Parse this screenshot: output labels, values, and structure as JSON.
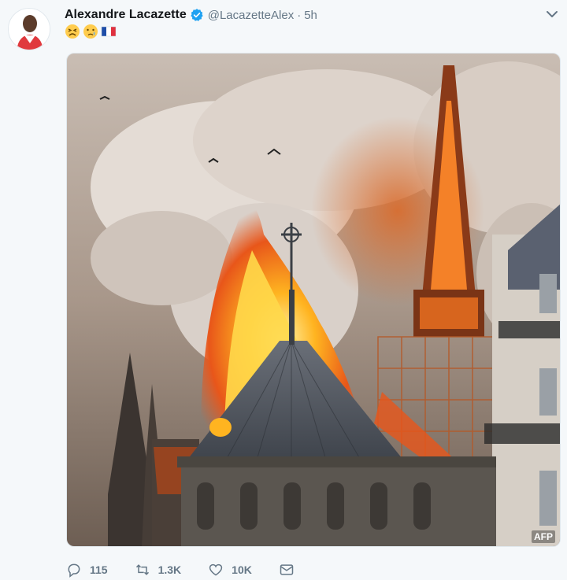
{
  "tweet": {
    "author_name": "Alexandre Lacazette",
    "handle": "@LacazetteAlex",
    "separator": "·",
    "time": "5h",
    "emojis": [
      "tired-face-emoji",
      "crying-face-emoji",
      "flag-france-emoji"
    ],
    "photo_credit": "AFP",
    "photo_icon": "photo-notre-dame-fire"
  },
  "actions": {
    "reply_count": "115",
    "retweet_count": "1.3K",
    "like_count": "10K"
  },
  "colors": {
    "verified": "#1da1f2",
    "text_secondary": "#657786",
    "background": "#f5f8fa"
  }
}
